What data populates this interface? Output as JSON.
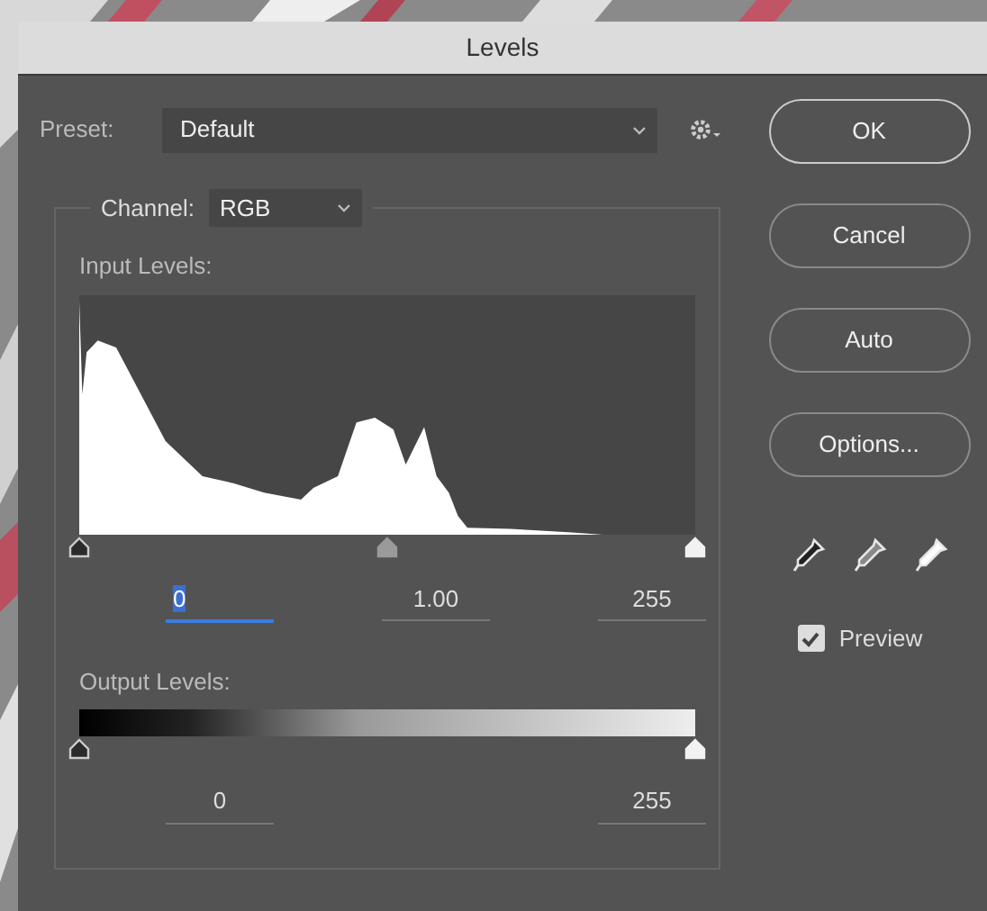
{
  "window": {
    "title": "Levels"
  },
  "preset": {
    "label": "Preset:",
    "value": "Default"
  },
  "channel": {
    "label": "Channel:",
    "value": "RGB"
  },
  "input_levels": {
    "label": "Input Levels:",
    "fields": [
      {
        "value": "0",
        "focused": true
      },
      {
        "value": "1.00",
        "focused": false
      },
      {
        "value": "255",
        "focused": false
      }
    ]
  },
  "output_levels": {
    "label": "Output Levels:",
    "fields": [
      {
        "value": "0",
        "focused": false
      },
      {
        "value": "255",
        "focused": false
      }
    ]
  },
  "buttons": [
    {
      "label": "OK",
      "default": true
    },
    {
      "label": "Cancel",
      "default": false
    },
    {
      "label": "Auto",
      "default": false
    },
    {
      "label": "Options...",
      "default": false
    }
  ],
  "eyedroppers": [
    {
      "kind": "black"
    },
    {
      "kind": "gray"
    },
    {
      "kind": "white"
    }
  ],
  "preview": {
    "label": "Preview",
    "checked": true
  }
}
